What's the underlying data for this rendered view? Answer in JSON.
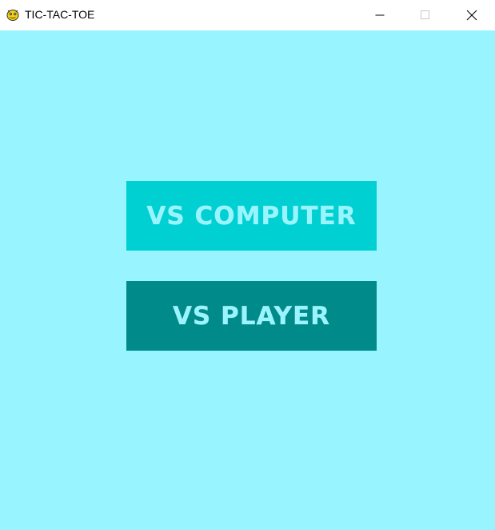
{
  "window": {
    "title": "TIC-TAC-TOE",
    "app_icon": "pygame-snake-icon",
    "controls": {
      "minimize_icon": "minimize-icon",
      "maximize_icon": "maximize-icon",
      "close_icon": "close-icon"
    }
  },
  "menu": {
    "background_color": "#98f4fe",
    "buttons": [
      {
        "label": "VS COMPUTER",
        "background_color": "#00d0d2",
        "text_color": "#98f4fe"
      },
      {
        "label": "VS PLAYER",
        "background_color": "#008a8a",
        "text_color": "#98f4fe"
      }
    ]
  }
}
